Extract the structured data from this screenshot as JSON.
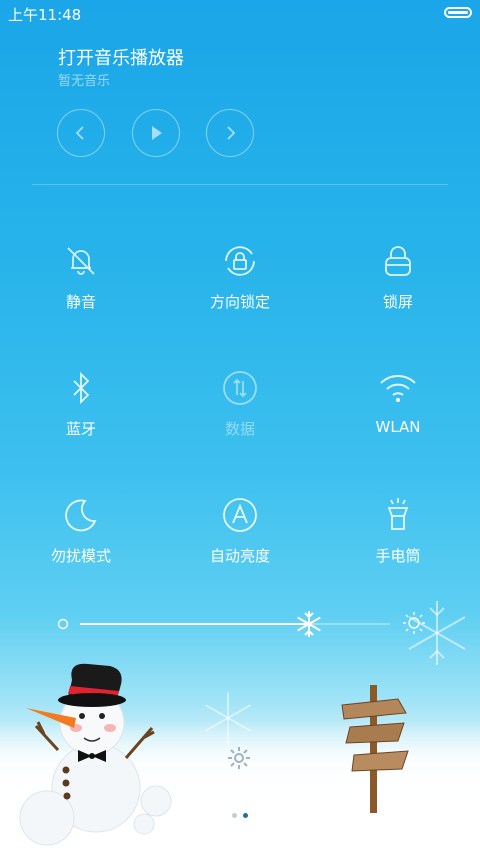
{
  "status": {
    "time": "上午11:48"
  },
  "music": {
    "title": "打开音乐播放器",
    "subtitle": "暂无音乐",
    "controls": [
      "previous",
      "play",
      "next"
    ]
  },
  "toggles": [
    {
      "label": "静音",
      "icon": "bell-off-icon",
      "enabled": true
    },
    {
      "label": "方向锁定",
      "icon": "rotation-lock-icon",
      "enabled": true
    },
    {
      "label": "锁屏",
      "icon": "lock-icon",
      "enabled": true
    },
    {
      "label": "蓝牙",
      "icon": "bluetooth-icon",
      "enabled": true
    },
    {
      "label": "数据",
      "icon": "mobile-data-icon",
      "enabled": false
    },
    {
      "label": "WLAN",
      "icon": "wifi-icon",
      "enabled": true
    },
    {
      "label": "勿扰模式",
      "icon": "moon-icon",
      "enabled": true
    },
    {
      "label": "自动亮度",
      "icon": "auto-brightness-icon",
      "enabled": true
    },
    {
      "label": "手电筒",
      "icon": "flashlight-icon",
      "enabled": true
    }
  ],
  "brightness": {
    "level": 0.74
  },
  "pager": {
    "count": 2,
    "active": 1
  },
  "colors": {
    "accent": "#1aa6e8",
    "text": "#ffffff"
  }
}
